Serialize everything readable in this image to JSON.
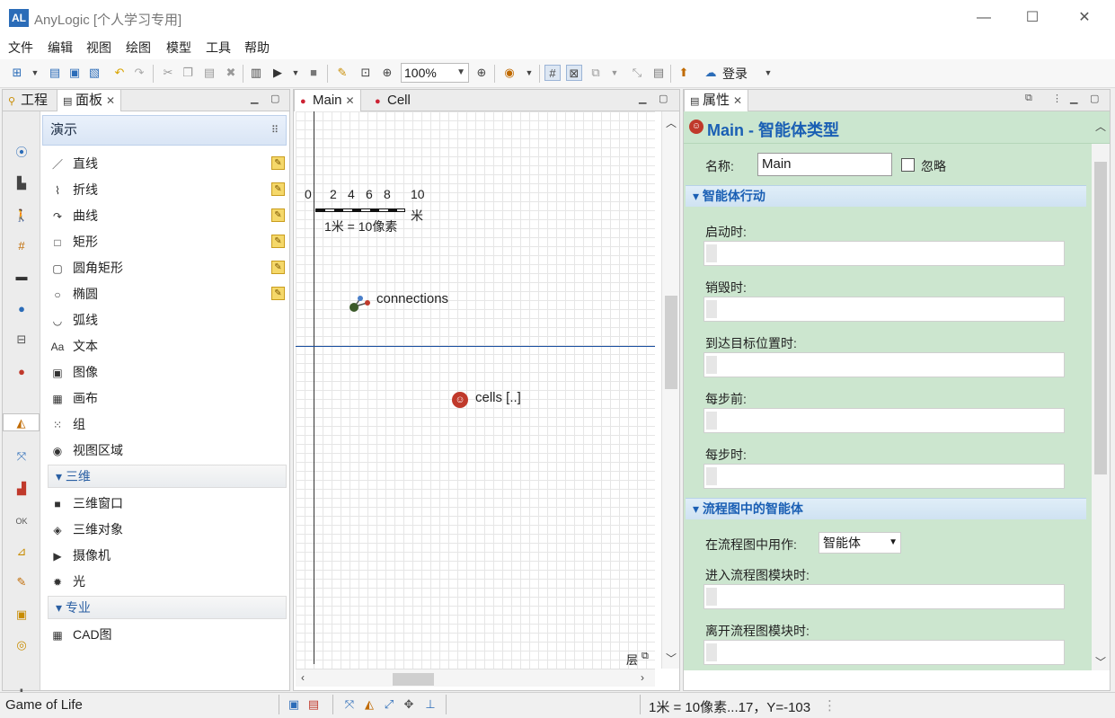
{
  "window": {
    "title": "AnyLogic [个人学习专用]",
    "logo_text": "AL",
    "controls": [
      "—",
      "☐",
      "✕"
    ]
  },
  "menubar": [
    "文件",
    "编辑",
    "视图",
    "绘图",
    "模型",
    "工具",
    "帮助"
  ],
  "toolbar": {
    "zoom": "100%",
    "login_label": "登录"
  },
  "left_panel": {
    "tabs": [
      {
        "label": "工程",
        "icon": "project-tree-icon"
      },
      {
        "label": "面板",
        "icon": "palette-icon",
        "closable": true
      }
    ],
    "palette_header": "演示",
    "items": [
      {
        "label": "直线",
        "icon": "line-icon",
        "glyph": "／",
        "editable": true
      },
      {
        "label": "折线",
        "icon": "polyline-icon",
        "glyph": "⌇",
        "editable": true
      },
      {
        "label": "曲线",
        "icon": "curve-icon",
        "glyph": "↷",
        "editable": true
      },
      {
        "label": "矩形",
        "icon": "rectangle-icon",
        "glyph": "□",
        "editable": true
      },
      {
        "label": "圆角矩形",
        "icon": "rounded-rectangle-icon",
        "glyph": "▢",
        "editable": true
      },
      {
        "label": "椭圆",
        "icon": "oval-icon",
        "glyph": "○",
        "editable": true
      },
      {
        "label": "弧线",
        "icon": "arc-icon",
        "glyph": "◡",
        "editable": false
      },
      {
        "label": "文本",
        "icon": "text-icon",
        "glyph": "Aa",
        "editable": false
      },
      {
        "label": "图像",
        "icon": "image-icon",
        "glyph": "▣",
        "editable": false
      },
      {
        "label": "画布",
        "icon": "canvas-icon",
        "glyph": "▦",
        "editable": false
      },
      {
        "label": "组",
        "icon": "group-icon",
        "glyph": "⁙",
        "editable": false
      },
      {
        "label": "视图区域",
        "icon": "view-area-icon",
        "glyph": "◉",
        "editable": false
      }
    ],
    "section_3d": "三维",
    "items_3d": [
      {
        "label": "三维窗口",
        "icon": "3d-window-icon",
        "glyph": "■"
      },
      {
        "label": "三维对象",
        "icon": "3d-object-icon",
        "glyph": "◈"
      },
      {
        "label": "摄像机",
        "icon": "camera-icon",
        "glyph": "▶"
      },
      {
        "label": "光",
        "icon": "light-icon",
        "glyph": "✹"
      }
    ],
    "section_pro": "专业",
    "items_pro": [
      {
        "label": "CAD图",
        "icon": "cad-icon",
        "glyph": "▦"
      }
    ],
    "strip_icons": [
      "process-icon",
      "factory-icon",
      "pedestrian-icon",
      "rail-icon",
      "car-icon",
      "fluid-icon",
      "system-dynamics-icon",
      "agent-icon",
      "presentation-icon",
      "statechart-icon",
      "analysis-icon",
      "controls-icon",
      "connectivity-icon",
      "pictures-icon",
      "3d-objects-icon",
      "marketplace-icon"
    ],
    "add_icon": "✚"
  },
  "editor": {
    "tabs": [
      {
        "label": "Main",
        "closable": true
      },
      {
        "label": "Cell",
        "closable": false
      }
    ],
    "scale_ticks": [
      "0",
      "2",
      "4",
      "6",
      "8",
      "10"
    ],
    "scale_unit": "米",
    "scale_label": "1米 = 10像素",
    "connections_label": "connections",
    "cells_label": "cells [..]",
    "layers_label": "层"
  },
  "properties": {
    "tab_label": "属性",
    "title": "Main - 智能体类型",
    "name_label": "名称:",
    "name_value": "Main",
    "ignore_label": "忽略",
    "ignore_checked": false,
    "section_actions": "智能体行动",
    "action_fields": [
      "启动时:",
      "销毁时:",
      "到达目标位置时:",
      "每步前:",
      "每步时:"
    ],
    "section_flowchart": "流程图中的智能体",
    "use_as_label": "在流程图中用作:",
    "use_as_value": "智能体",
    "flow_fields": [
      "进入流程图模块时:",
      "离开流程图模块时:"
    ]
  },
  "statusbar": {
    "model_name": "Game of Life",
    "coords": "1米 = 10像素...17，Y=-103"
  },
  "colors": {
    "prop_bg": "#cce6cf",
    "accent_blue": "#1a5fb4",
    "agent_red": "#c0392b"
  }
}
